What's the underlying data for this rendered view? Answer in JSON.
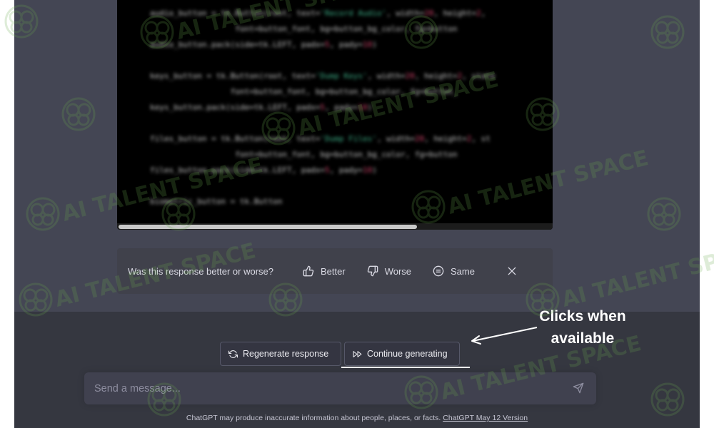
{
  "code": {
    "lines": [
      [
        {
          "t": "audio_button = tk.Button(root, text="
        },
        {
          "t": "'Record Audio'",
          "c": "str"
        },
        {
          "t": ", width="
        },
        {
          "t": "20",
          "c": "num"
        },
        {
          "t": ", height="
        },
        {
          "t": "2",
          "c": "num"
        },
        {
          "t": ","
        }
      ],
      [
        {
          "t": "                  font=button_font, bg=button_bg_color, fg=button"
        }
      ],
      [
        {
          "t": "audio_button.pack(side=tk.LEFT, padx="
        },
        {
          "t": "5",
          "c": "num"
        },
        {
          "t": ", pady="
        },
        {
          "t": "10",
          "c": "num"
        },
        {
          "t": ")"
        }
      ],
      [],
      [
        {
          "t": "keys_button = tk.Button(root, text="
        },
        {
          "t": "'Dump Keys'",
          "c": "str"
        },
        {
          "t": ", width="
        },
        {
          "t": "20",
          "c": "num"
        },
        {
          "t": ", height="
        },
        {
          "t": "2",
          "c": "num"
        },
        {
          "t": ", state"
        }
      ],
      [
        {
          "t": "                 font=button_font, bg=button_bg_color, fg=button_"
        }
      ],
      [
        {
          "t": "keys_button.pack(side=tk.LEFT, padx="
        },
        {
          "t": "5",
          "c": "num"
        },
        {
          "t": ", pady="
        },
        {
          "t": "10",
          "c": "num"
        },
        {
          "t": ")"
        }
      ],
      [],
      [
        {
          "t": "files_button = tk.Button(root, text="
        },
        {
          "t": "'Dump Files'",
          "c": "str"
        },
        {
          "t": ", width="
        },
        {
          "t": "20",
          "c": "num"
        },
        {
          "t": ", height="
        },
        {
          "t": "2",
          "c": "num"
        },
        {
          "t": ", st"
        }
      ],
      [
        {
          "t": "                  font=button_font, bg=button_bg_color, fg=button"
        }
      ],
      [
        {
          "t": "files_button.pack(side=tk.LEFT, padx="
        },
        {
          "t": "5",
          "c": "num"
        },
        {
          "t": ", pady="
        },
        {
          "t": "10",
          "c": "num"
        },
        {
          "t": ")"
        }
      ],
      [],
      [
        {
          "t": "biometric_button = tk.Button"
        }
      ]
    ]
  },
  "feedback": {
    "question": "Was this response better or worse?",
    "better_label": "Better",
    "worse_label": "Worse",
    "same_label": "Same"
  },
  "actions": {
    "regenerate_label": "Regenerate response",
    "continue_label": "Continue generating"
  },
  "callout": {
    "line1": "Clicks when",
    "line2": "available"
  },
  "composer": {
    "placeholder": "Send a message..."
  },
  "footer": {
    "disclaimer": "ChatGPT may produce inaccurate information about people, places, or facts.",
    "version_link": "ChatGPT May 12 Version"
  },
  "watermark": {
    "text": "AI TALENT SPACE"
  },
  "colors": {
    "app_bg": "#444654",
    "bottom_bg": "#353740",
    "watermark": "#4f7a3a"
  }
}
